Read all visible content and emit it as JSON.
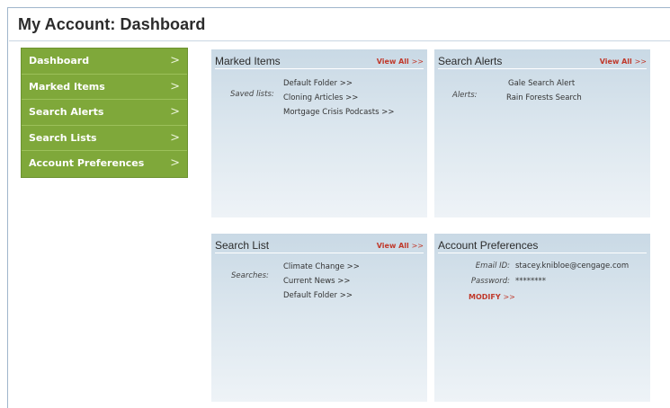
{
  "page": {
    "title": "My Account: Dashboard"
  },
  "sidebar": {
    "items": [
      {
        "label": "Dashboard",
        "chevron": ">"
      },
      {
        "label": "Marked Items",
        "chevron": ">"
      },
      {
        "label": "Search Alerts",
        "chevron": ">"
      },
      {
        "label": "Search Lists",
        "chevron": ">"
      },
      {
        "label": "Account Preferences",
        "chevron": ">"
      }
    ]
  },
  "panels": {
    "marked_items": {
      "title": "Marked Items",
      "view_all": "View All",
      "view_all_arrow": ">>",
      "field_label": "Saved lists:",
      "items": [
        "Default Folder >>",
        "Cloning Articles >>",
        "Mortgage Crisis Podcasts >>"
      ]
    },
    "search_alerts": {
      "title": "Search Alerts",
      "view_all": "View All",
      "view_all_arrow": ">>",
      "field_label": "Alerts:",
      "items": [
        "Gale Search Alert",
        "Rain Forests Search"
      ]
    },
    "search_list": {
      "title": "Search List",
      "view_all": "View All",
      "view_all_arrow": ">>",
      "field_label": "Searches:",
      "items": [
        "Climate Change >>",
        "Current News >>",
        "Default Folder >>"
      ]
    },
    "account_preferences": {
      "title": "Account Preferences",
      "email_label": "Email ID:",
      "email_value": "stacey.knibloe@cengage.com",
      "password_label": "Password:",
      "password_value": "********",
      "modify": "MODIFY",
      "modify_arrow": ">>"
    }
  },
  "colors": {
    "sidebar_bg": "#7fa83a",
    "link_red": "#c0392b",
    "panel_top": "#c9d9e5",
    "panel_bottom": "#eef3f7"
  }
}
